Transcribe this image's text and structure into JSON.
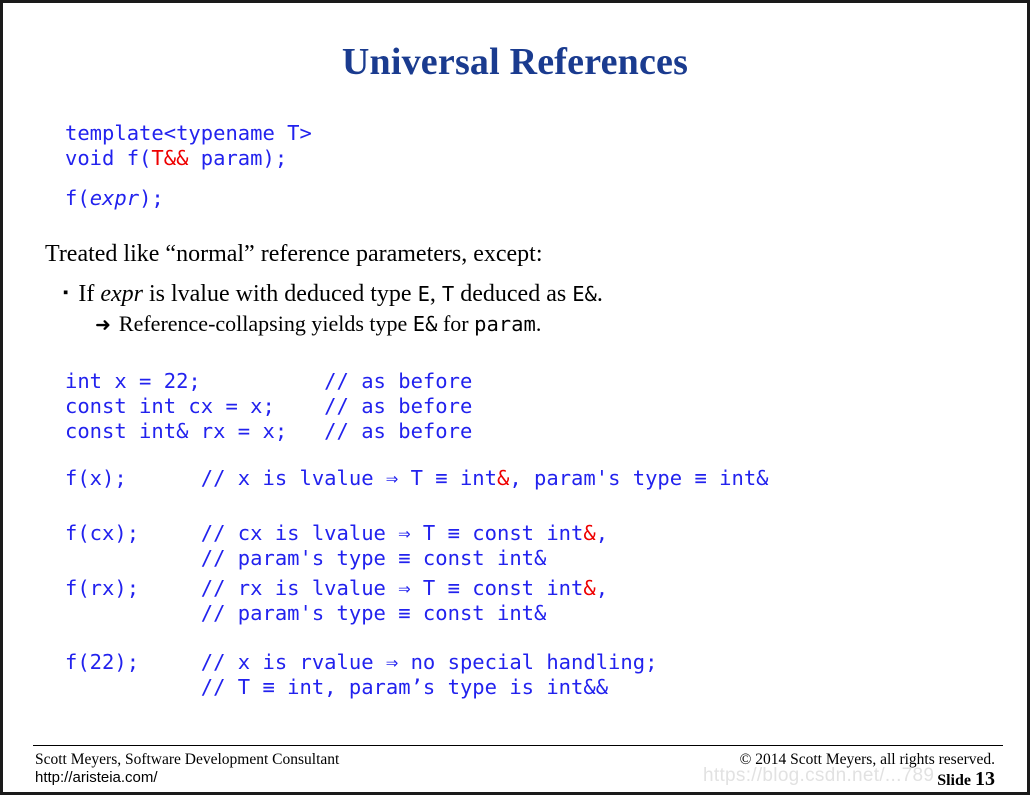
{
  "slide": {
    "title": "Universal References",
    "number_label": "Slide",
    "number": "13"
  },
  "code_signature": {
    "line1_a": "template<typename T>",
    "line2_a": "void f(",
    "line2_red": "T&&",
    "line2_b": " param);"
  },
  "code_call": {
    "a": "f(",
    "expr": "expr",
    "b": ");"
  },
  "prose": {
    "treated": "Treated like “normal” reference parameters, except:"
  },
  "bullets": [
    {
      "marker": "▪",
      "pre": "If ",
      "italic": "expr",
      "mid": " is lvalue with deduced type ",
      "mono1": "E",
      "mid2": ", ",
      "mono2": "T",
      "mid3": " deduced as ",
      "mono3": "E&",
      "post": "."
    },
    {
      "marker": "➜",
      "pre": "Reference-collapsing yields type ",
      "mono1": "E&",
      "mid": " for ",
      "mono2": "param",
      "post": "."
    }
  ],
  "code_decls": {
    "line1": "int x = 22;          // as before",
    "line2": "const int cx = x;    // as before",
    "line3": "const int& rx = x;   // as before"
  },
  "code_fx": {
    "a": "f(x);      // x is lvalue ⇒ T ≡ int",
    "red": "&",
    "b": ", param's type ≡ int&"
  },
  "code_fcx": {
    "a": "f(cx);     // cx is lvalue ⇒ T ≡ const int",
    "red": "&",
    "b": ",",
    "line2": "           // param's type ≡ const int&"
  },
  "code_frx": {
    "a": "f(rx);     // rx is lvalue ⇒ T ≡ const int",
    "red": "&",
    "b": ",",
    "line2": "           // param's type ≡ const int&"
  },
  "code_f22": {
    "line1": "f(22);     // x is rvalue ⇒ no special handling;",
    "line2": "           // T ≡ int, param’s type is int&&"
  },
  "footer": {
    "left_line1": "Scott Meyers, Software Development Consultant",
    "left_line2": "http://aristeia.com/",
    "copyright": "© 2014 Scott Meyers, all rights reserved."
  },
  "watermark": {
    "text": "https://blog.csdn.net/...789"
  },
  "colors": {
    "title_blue": "#1a3b8f",
    "code_blue": "#2222ee",
    "accent_red": "#ee0000"
  }
}
